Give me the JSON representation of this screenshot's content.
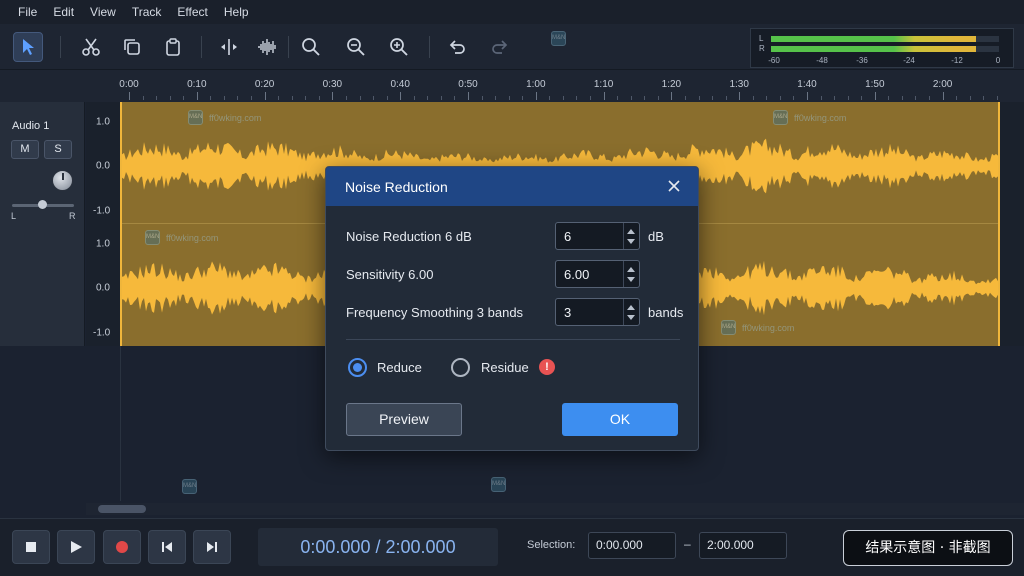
{
  "menu": [
    "File",
    "Edit",
    "View",
    "Track",
    "Effect",
    "Help"
  ],
  "toolbar": {
    "tools": [
      "selection-tool",
      "cut",
      "copy",
      "paste",
      "split",
      "silence",
      "zoom-fit",
      "zoom-out",
      "zoom-in",
      "undo",
      "redo"
    ]
  },
  "meter": {
    "left_label": "L",
    "right_label": "R",
    "scale": [
      "-60",
      "-48",
      "-36",
      "-24",
      "-12",
      "0"
    ],
    "left_level": 0.9,
    "right_level": 0.9
  },
  "timeline": {
    "labels": [
      "0:00",
      "0:10",
      "0:20",
      "0:30",
      "0:40",
      "0:50",
      "1:00",
      "1:10",
      "1:20",
      "1:30",
      "1:40",
      "1:50",
      "2:00"
    ]
  },
  "track": {
    "name": "Audio 1",
    "mute_label": "M",
    "solo_label": "S",
    "pan_left": "L",
    "pan_right": "R",
    "amplitude_labels": [
      "1.0",
      "0.0",
      "-1.0",
      "1.0",
      "0.0",
      "-1.0"
    ]
  },
  "dialog": {
    "title": "Noise Reduction",
    "fields": [
      {
        "label": "Noise Reduction 6 dB",
        "value": "6",
        "unit": "dB"
      },
      {
        "label": "Sensitivity 6.00",
        "value": "6.00",
        "unit": ""
      },
      {
        "label": "Frequency Smoothing 3 bands",
        "value": "3",
        "unit": "bands"
      }
    ],
    "reduce_label": "Reduce",
    "residue_label": "Residue",
    "warning_glyph": "!",
    "preview_label": "Preview",
    "ok_label": "OK"
  },
  "transport": {
    "current_time": "0:00.000",
    "time_separator": "/",
    "total_time": "2:00.000",
    "selection_label": "Selection:",
    "selection_start": "0:00.000",
    "selection_dash": "–",
    "selection_end": "2:00.000",
    "badge": "结果示意图 · 非截图"
  },
  "watermark": {
    "logo": "M&N",
    "text": "ff0wking.com"
  },
  "colors": {
    "accent_blue": "#3d8ef0",
    "dialog_header": "#1f4685",
    "waveform": "#f6b93b",
    "clip_background": "#8a6e2d",
    "warning": "#e85353",
    "meter_green": "#56c24a"
  }
}
